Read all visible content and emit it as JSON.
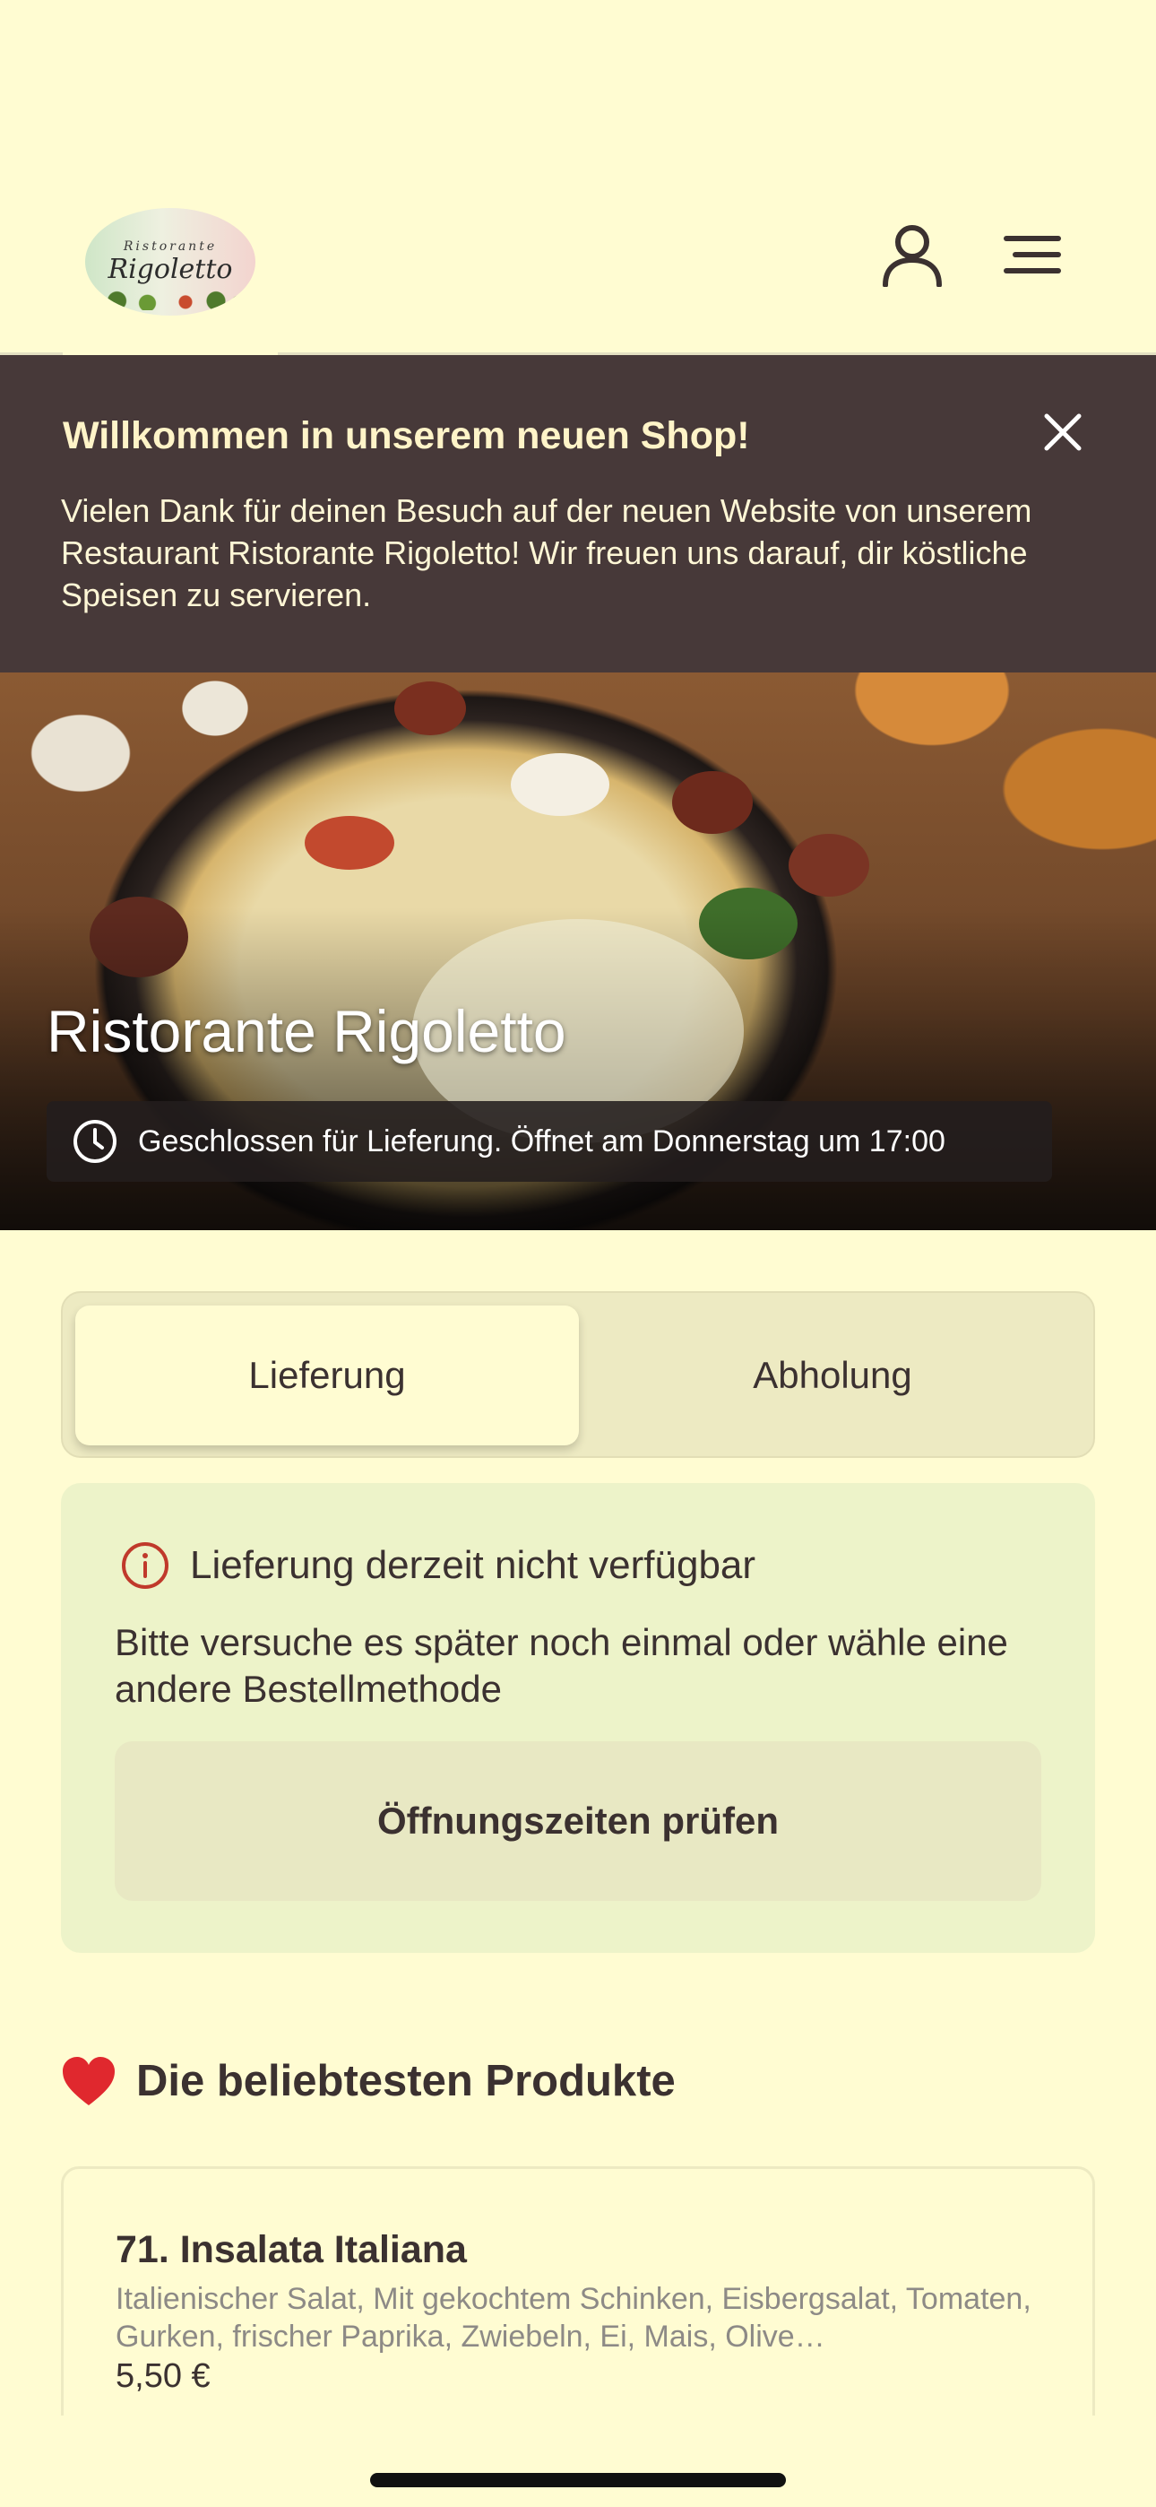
{
  "header": {
    "logo_text_small": "Ristorante",
    "logo_text_big": "Rigoletto",
    "user_icon": "user-icon",
    "menu_icon": "menu-icon"
  },
  "banner": {
    "title": "Willkommen in unserem neuen Shop!",
    "text": "Vielen Dank für deinen Besuch auf der neuen Website von unserem Restaurant Ristorante Rigoletto! Wir freuen uns darauf, dir köstliche Speisen zu servieren.",
    "close_icon": "close-icon"
  },
  "hero": {
    "title": "Ristorante Rigoletto",
    "hours_text": "Geschlossen für Lieferung. Öffnet am Donnerstag um 17:00",
    "clock_icon": "clock-icon"
  },
  "order_method": {
    "options": [
      "Lieferung",
      "Abholung"
    ],
    "selected": "Lieferung"
  },
  "notice": {
    "title": "Lieferung derzeit nicht verfügbar",
    "text": "Bitte versuche es später noch einmal oder wähle eine andere Bestellmethode",
    "button_label": "Öffnungszeiten prüfen",
    "info_icon": "info-icon"
  },
  "popular": {
    "title": "Die beliebtesten Produkte",
    "heart_icon": "heart-icon",
    "products": [
      {
        "name": "71. Insalata Italiana",
        "description": "Italienischer Salat, Mit gekochtem Schinken, Eisbergsalat, Tomaten, Gurken, frischer Paprika, Zwiebeln, Ei, Mais, Olive…",
        "price": "5,50 €"
      }
    ]
  },
  "colors": {
    "background": "#FFFCD2",
    "banner": "#473939",
    "text": "#3B3130",
    "notice_bg": "#EDF3C9",
    "alert_red": "#C0392B"
  }
}
